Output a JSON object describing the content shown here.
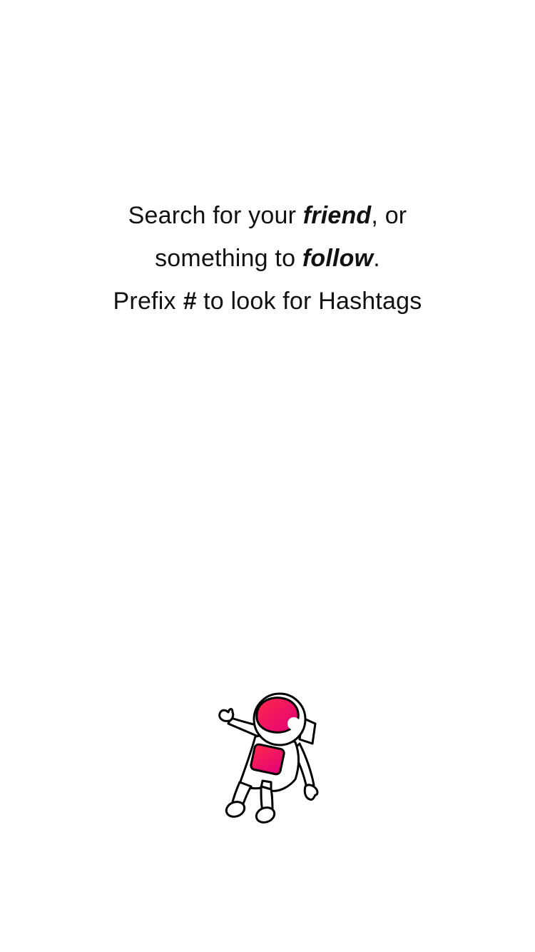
{
  "empty_state": {
    "line1": {
      "prefix": "Search for your ",
      "emphasis": "friend",
      "suffix": ", or"
    },
    "line2": {
      "prefix": "something to ",
      "emphasis": "follow",
      "suffix": "."
    },
    "line3": {
      "prefix": "Prefix ",
      "emphasis": "#",
      "suffix": " to look for Hashtags"
    }
  },
  "illustration": {
    "icon": "astronaut-icon",
    "accent_colors": [
      "#ff1f55",
      "#e0007a"
    ],
    "outline_color": "#000000"
  }
}
